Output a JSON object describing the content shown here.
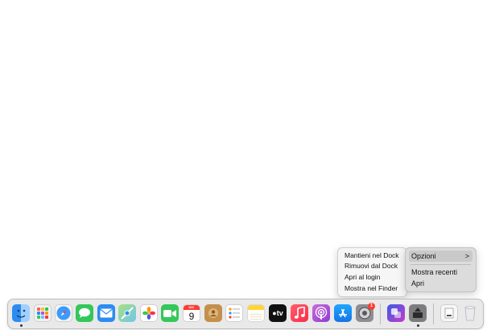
{
  "context_menu": {
    "items": [
      {
        "label": "Opzioni",
        "has_submenu": true,
        "highlighted": true
      },
      {
        "label": "Mostra recenti"
      },
      {
        "label": "Apri"
      }
    ],
    "submenu_arrow": ">"
  },
  "options_submenu": {
    "items": [
      {
        "label": "Mantieni nel Dock"
      },
      {
        "label": "Rimuovi dal Dock"
      },
      {
        "label": "Apri al login"
      },
      {
        "label": "Mostra nel Finder"
      }
    ]
  },
  "dock": {
    "apps": [
      {
        "name": "finder-icon",
        "running": true
      },
      {
        "name": "launchpad-icon"
      },
      {
        "name": "safari-icon"
      },
      {
        "name": "messages-icon"
      },
      {
        "name": "mail-icon"
      },
      {
        "name": "maps-icon"
      },
      {
        "name": "photos-icon"
      },
      {
        "name": "facetime-icon"
      },
      {
        "name": "calendar-icon",
        "month": "DIC",
        "day": "9"
      },
      {
        "name": "contacts-icon"
      },
      {
        "name": "reminders-icon"
      },
      {
        "name": "notes-icon"
      },
      {
        "name": "apple-tv-icon",
        "text": "tv"
      },
      {
        "name": "music-icon"
      },
      {
        "name": "podcasts-icon"
      },
      {
        "name": "app-store-icon"
      },
      {
        "name": "system-preferences-icon",
        "badge": "1"
      },
      {
        "name": "shortcuts-icon"
      },
      {
        "name": "installer-app-icon",
        "running": true
      },
      {
        "name": "document-icon"
      },
      {
        "name": "trash-icon"
      }
    ],
    "colors": {
      "background": "#e9e9e9",
      "running_dot": "#333333",
      "badge": "#ff3b30"
    }
  }
}
